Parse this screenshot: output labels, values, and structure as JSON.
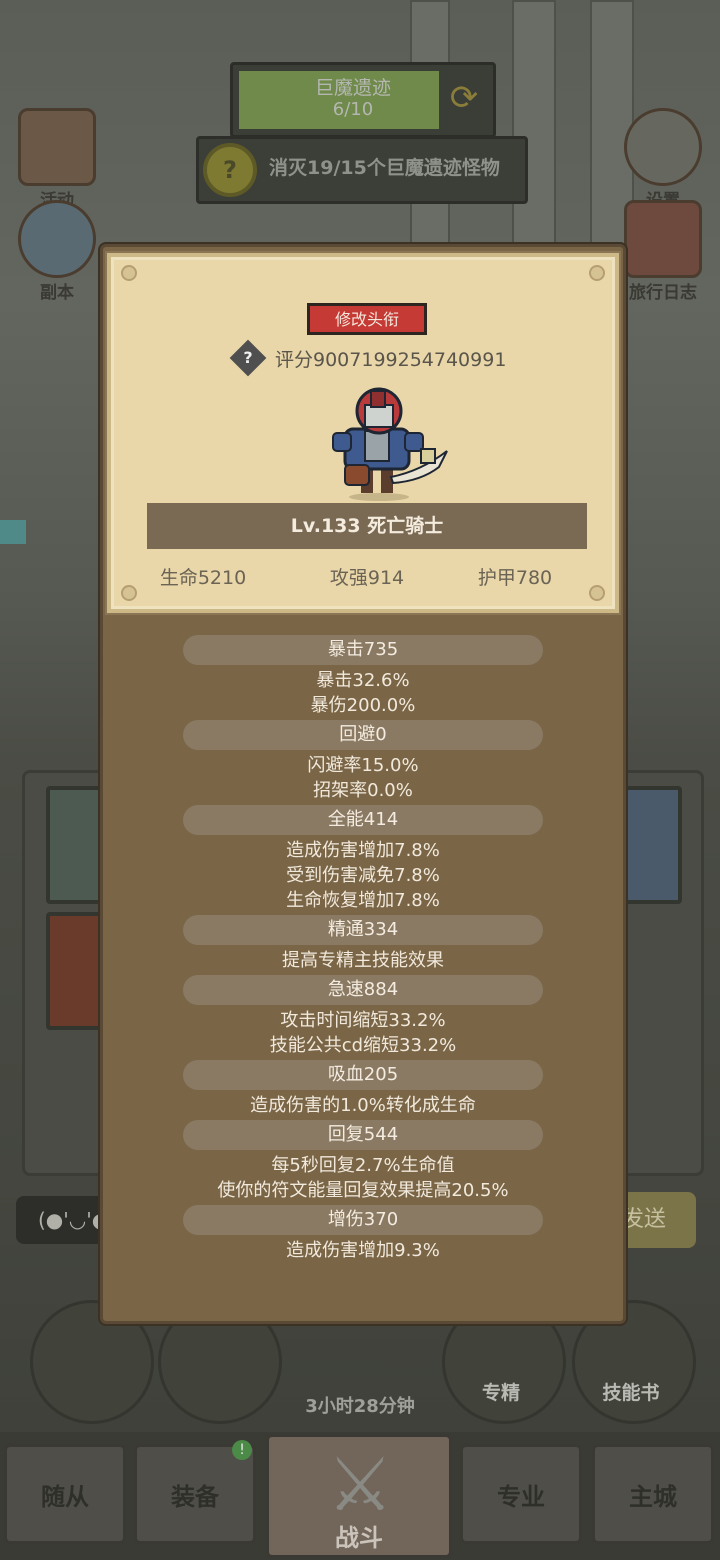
{
  "scene": {
    "zone": {
      "title": "巨魔遗迹",
      "progress": "6/10"
    },
    "quest": {
      "icon": "?",
      "text": "消灭19/15个巨魔遗迹怪物"
    },
    "side_left": [
      {
        "label": "活动",
        "icon": "scroll-icon"
      },
      {
        "label": "副本",
        "icon": "portal-icon"
      }
    ],
    "side_right": [
      {
        "label": "设置",
        "icon": "gear-icon"
      },
      {
        "label": "旅行日志",
        "icon": "book-icon"
      }
    ],
    "chat_emote": "(●'◡'●",
    "send_label": "发送",
    "round_buttons": [
      {
        "label": "",
        "icon": "potion-icon"
      },
      {
        "label": "",
        "icon": "bread-icon"
      },
      {
        "label": "专精",
        "icon": "spec-icon"
      },
      {
        "label": "技能书",
        "icon": "skillbook-icon"
      }
    ],
    "chest_timer": "3小时28分钟",
    "tabs": [
      "随从",
      "装备",
      "战斗",
      "专业",
      "主城"
    ],
    "active_tab": "战斗",
    "badge": "!"
  },
  "popup": {
    "title_button": "修改头衔",
    "score": "评分9007199254740991",
    "level_name": "Lv.133 死亡骑士",
    "hp": "生命5210",
    "atk": "攻强914",
    "armor": "护甲780",
    "attributes": [
      {
        "name": "暴击735",
        "lines": [
          "暴击32.6%",
          "暴伤200.0%"
        ]
      },
      {
        "name": "回避0",
        "lines": [
          "闪避率15.0%",
          "招架率0.0%"
        ]
      },
      {
        "name": "全能414",
        "lines": [
          "造成伤害增加7.8%",
          "受到伤害减免7.8%",
          "生命恢复增加7.8%"
        ]
      },
      {
        "name": "精通334",
        "lines": [
          "提高专精主技能效果"
        ]
      },
      {
        "name": "急速884",
        "lines": [
          "攻击时间缩短33.2%",
          "技能公共cd缩短33.2%"
        ]
      },
      {
        "name": "吸血205",
        "lines": [
          "造成伤害的1.0%转化成生命"
        ]
      },
      {
        "name": "回复544",
        "lines": [
          "每5秒回复2.7%生命值",
          "使你的符文能量回复效果提高20.5%"
        ]
      },
      {
        "name": "增伤370",
        "lines": [
          "造成伤害增加9.3%"
        ]
      }
    ]
  }
}
